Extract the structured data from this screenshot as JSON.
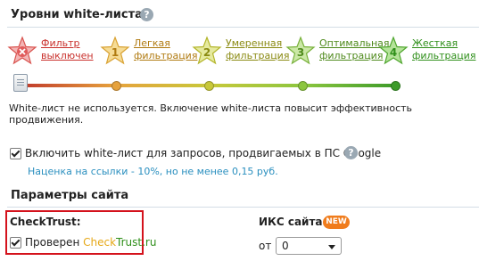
{
  "whitelist": {
    "title": "Уровни white-листа",
    "help": "?",
    "levels": [
      {
        "line1": "Фильтр",
        "line2": "выключен",
        "number": "",
        "color": "#d9534f",
        "label_color": "#c9302c"
      },
      {
        "line1": "Легкая",
        "line2": "фильтрация",
        "number": "1",
        "color": "#e8b84a",
        "label_color": "#b07a10"
      },
      {
        "line1": "Умеренная",
        "line2": "фильтрация",
        "number": "2",
        "color": "#c9d25a",
        "label_color": "#8a8a12"
      },
      {
        "line1": "Оптимальная",
        "line2": "фильтрация",
        "number": "3",
        "color": "#9fcf6a",
        "label_color": "#4f8a1c"
      },
      {
        "line1": "Жесткая",
        "line2": "фильтрация",
        "number": "4",
        "color": "#6cc04a",
        "label_color": "#2f8f1a"
      }
    ],
    "slider_value": 0,
    "slider_colors": [
      "#c0392b",
      "#e6a23c",
      "#c8c83a",
      "#8cc63f",
      "#3d9b2a"
    ],
    "status_text": "White-лист не используется. Включение white-листа повысит эффективность продвижения.",
    "google_checkbox": {
      "label": "Включить white-лист для запросов, продвигаемых в ПС Google",
      "checked": true,
      "help": "?"
    },
    "markup_text": "Наценка на ссылки - 10%, но не менее 0,15 руб."
  },
  "site_params": {
    "title": "Параметры сайта",
    "checktrust": {
      "heading": "CheckTrust:",
      "checkbox_label": "Проверен",
      "brand_part1": "Check",
      "brand_part2": "Trust",
      "brand_part3": ".ru",
      "checked": true
    },
    "iks": {
      "label": "ИКС сайта:",
      "badge": "NEW",
      "from_label": "от",
      "value": "0"
    }
  }
}
